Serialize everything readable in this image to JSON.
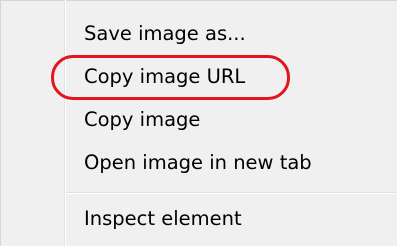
{
  "context_menu": {
    "items": [
      {
        "label": "Save image as..."
      },
      {
        "label": "Copy image URL"
      },
      {
        "label": "Copy image"
      },
      {
        "label": "Open image in new tab"
      },
      {
        "label": "Inspect element"
      }
    ],
    "highlighted_item": "Copy image URL"
  },
  "colors": {
    "menu_background": "#f0f0f0",
    "highlight_ring": "#e0151e"
  }
}
